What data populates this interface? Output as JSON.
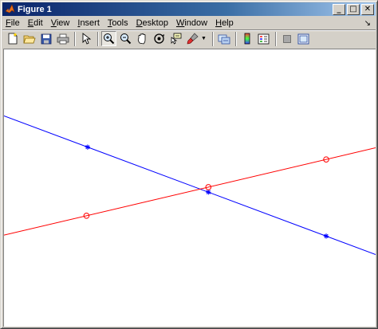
{
  "window": {
    "title": "Figure 1",
    "icon": "matlab-logo-icon",
    "controls": {
      "minimize": "_",
      "maximize": "□",
      "close": "✕"
    }
  },
  "menubar": {
    "items": [
      {
        "label": "File",
        "accel": "F"
      },
      {
        "label": "Edit",
        "accel": "E"
      },
      {
        "label": "View",
        "accel": "V"
      },
      {
        "label": "Insert",
        "accel": "I"
      },
      {
        "label": "Tools",
        "accel": "T"
      },
      {
        "label": "Desktop",
        "accel": "D"
      },
      {
        "label": "Window",
        "accel": "W"
      },
      {
        "label": "Help",
        "accel": "H"
      }
    ],
    "overflow_arrow": "↘"
  },
  "toolbar": {
    "tools": [
      "new-figure-icon",
      "open-file-icon",
      "save-icon",
      "print-icon",
      "edit-plot-arrow-icon",
      "zoom-in-icon",
      "zoom-out-icon",
      "pan-hand-icon",
      "rotate-3d-icon",
      "data-cursor-icon",
      "brush-icon",
      "link-plot-icon",
      "colorbar-icon",
      "legend-icon",
      "hide-plot-tools-icon",
      "show-plot-tools-icon"
    ],
    "active_tool": "zoom-in-icon"
  },
  "plot": {
    "colors": {
      "blue": "#0000ff",
      "red": "#ff0000"
    },
    "series": [
      {
        "color": "blue",
        "marker": "*",
        "from": [
          0,
          0.76
        ],
        "to": [
          1,
          0.26
        ],
        "markers": [
          [
            0.225,
            0.6475
          ],
          [
            0.55,
            0.485
          ],
          [
            0.867,
            0.3265
          ]
        ]
      },
      {
        "color": "red",
        "marker": "o",
        "from": [
          0,
          0.33
        ],
        "to": [
          1,
          0.645
        ],
        "markers": [
          [
            0.222,
            0.4
          ],
          [
            0.55,
            0.503
          ],
          [
            0.867,
            0.603
          ]
        ]
      }
    ],
    "axes_visible": false
  }
}
